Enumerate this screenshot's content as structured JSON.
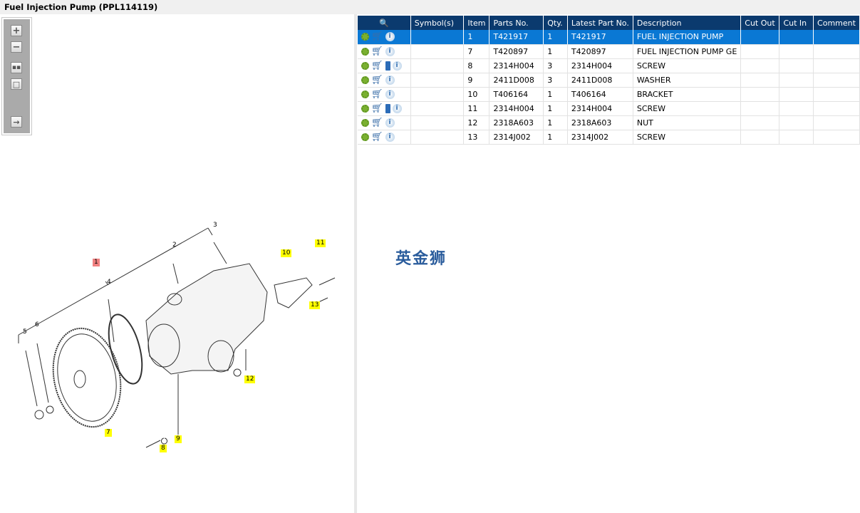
{
  "title": "Fuel Injection Pump (PPL114119)",
  "toolbar": [
    "zoom-in",
    "zoom-out",
    "fit-all",
    "fit-window",
    "export"
  ],
  "table": {
    "headers": [
      "Symbol(s)",
      "Item",
      "Parts No.",
      "Qty.",
      "Latest Part No.",
      "Description",
      "Cut Out",
      "Cut In",
      "Comment"
    ],
    "rows": [
      {
        "item": "1",
        "part": "T421917",
        "qty": "1",
        "latest": "T421917",
        "desc": "FUEL INJECTION PUMP",
        "book": false,
        "selected": true
      },
      {
        "item": "7",
        "part": "T420897",
        "qty": "1",
        "latest": "T420897",
        "desc": "FUEL INJECTION PUMP GE",
        "book": false
      },
      {
        "item": "8",
        "part": "2314H004",
        "qty": "3",
        "latest": "2314H004",
        "desc": "SCREW",
        "book": true
      },
      {
        "item": "9",
        "part": "2411D008",
        "qty": "3",
        "latest": "2411D008",
        "desc": "WASHER",
        "book": false
      },
      {
        "item": "10",
        "part": "T406164",
        "qty": "1",
        "latest": "T406164",
        "desc": "BRACKET",
        "book": false
      },
      {
        "item": "11",
        "part": "2314H004",
        "qty": "1",
        "latest": "2314H004",
        "desc": "SCREW",
        "book": true
      },
      {
        "item": "12",
        "part": "2318A603",
        "qty": "1",
        "latest": "2318A603",
        "desc": "NUT",
        "book": false
      },
      {
        "item": "13",
        "part": "2314J002",
        "qty": "1",
        "latest": "2314J002",
        "desc": "SCREW",
        "book": false
      }
    ]
  },
  "watermark": "英金狮",
  "callouts": {
    "c1": "1",
    "c2": "2",
    "c3": "3",
    "c4": "4",
    "c5": "5",
    "c6": "6",
    "c7": "7",
    "c8": "8",
    "c9": "9",
    "c10": "10",
    "c11": "11",
    "c12": "12",
    "c13": "13"
  }
}
